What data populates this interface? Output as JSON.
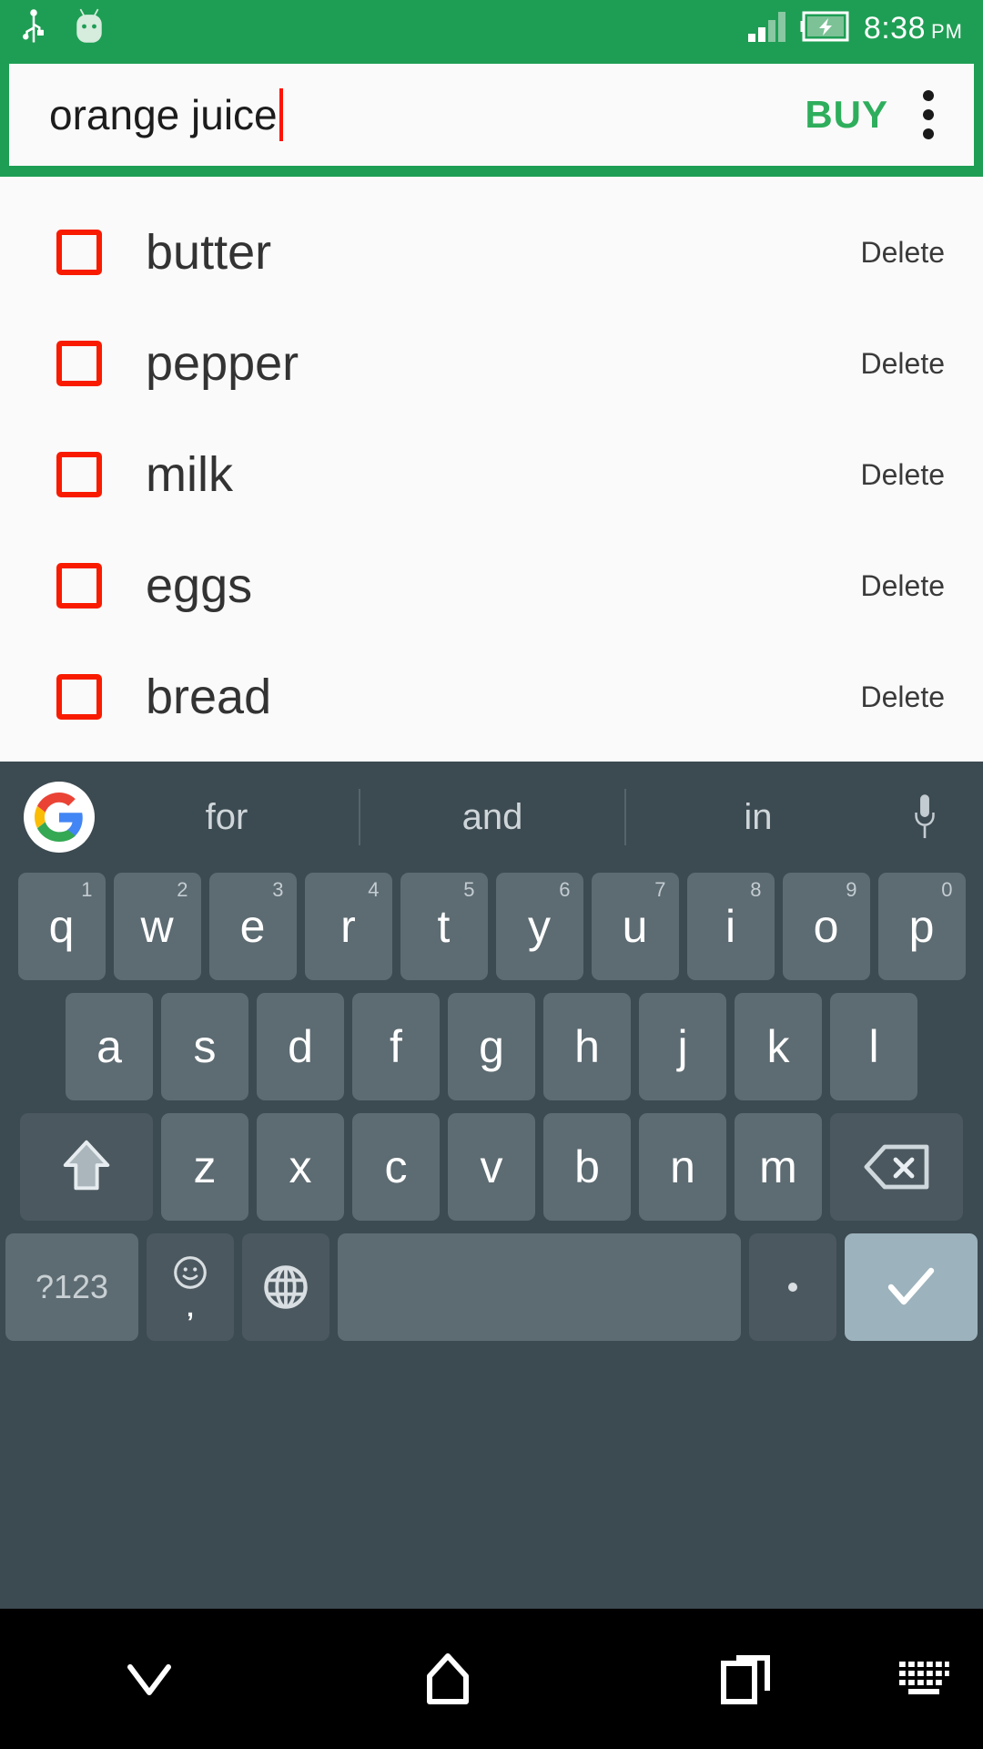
{
  "status_bar": {
    "icons": [
      "usb-icon",
      "android-head-icon",
      "signal-icon",
      "battery-charging-icon"
    ],
    "time": "8:38",
    "ampm": "PM",
    "background_color": "#1e9e54"
  },
  "app_bar": {
    "input_value": "orange juice",
    "input_placeholder": "",
    "buy_label": "BUY",
    "overflow_label": "More options",
    "accent_color": "#2eae5c",
    "caret_color": "#ff1500"
  },
  "list": {
    "delete_label": "Delete",
    "checkbox_color": "#f91b00",
    "items": [
      {
        "name": "butter",
        "checked": false,
        "delete": "Delete"
      },
      {
        "name": "pepper",
        "checked": false,
        "delete": "Delete"
      },
      {
        "name": "milk",
        "checked": false,
        "delete": "Delete"
      },
      {
        "name": "eggs",
        "checked": false,
        "delete": "Delete"
      },
      {
        "name": "bread",
        "checked": false,
        "delete": "Delete"
      }
    ]
  },
  "keyboard": {
    "background_color": "#3c4a51",
    "suggestions": [
      "for",
      "and",
      "in"
    ],
    "logo": "google-g-logo",
    "mic": "microphone-icon",
    "row1": [
      {
        "key": "q",
        "num": "1"
      },
      {
        "key": "w",
        "num": "2"
      },
      {
        "key": "e",
        "num": "3"
      },
      {
        "key": "r",
        "num": "4"
      },
      {
        "key": "t",
        "num": "5"
      },
      {
        "key": "y",
        "num": "6"
      },
      {
        "key": "u",
        "num": "7"
      },
      {
        "key": "i",
        "num": "8"
      },
      {
        "key": "o",
        "num": "9"
      },
      {
        "key": "p",
        "num": "0"
      }
    ],
    "row2": [
      "a",
      "s",
      "d",
      "f",
      "g",
      "h",
      "j",
      "k",
      "l"
    ],
    "row3": [
      "z",
      "x",
      "c",
      "v",
      "b",
      "n",
      "m"
    ],
    "shift_label": "shift-icon",
    "backspace_label": "backspace-icon",
    "symbols_label": "?123",
    "emoji_label": "emoji-icon",
    "emoji_secondary": ",",
    "globe_label": "globe-icon",
    "space_label": "",
    "period_label": ".",
    "enter_label": "checkmark-icon",
    "enter_color": "#9cb2bc"
  },
  "nav_bar": {
    "background_color": "#000000",
    "buttons": [
      "hide-keyboard-icon",
      "home-icon",
      "recents-icon",
      "keyboard-switch-icon"
    ]
  }
}
